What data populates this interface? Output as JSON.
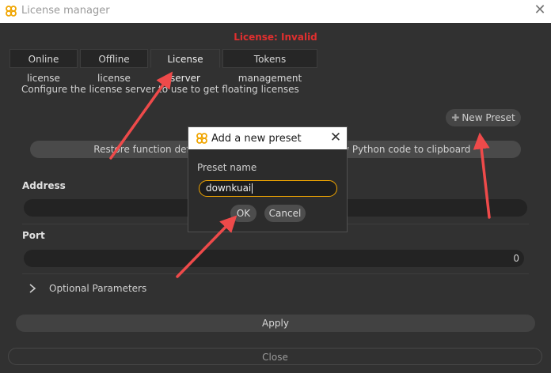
{
  "window": {
    "title": "License manager"
  },
  "status": {
    "text": "License: Invalid",
    "color": "#e02f2f"
  },
  "tabs": [
    {
      "label": "Online license"
    },
    {
      "label": "Offline license"
    },
    {
      "label": "License server",
      "active": true
    },
    {
      "label": "Tokens management"
    }
  ],
  "license_server": {
    "description": "Configure the license server to use to get floating licenses",
    "new_preset_label": "New Preset",
    "restore_label": "Restore function default",
    "copy_label": "Copy Python code to clipboard",
    "address_label": "Address",
    "address_value": "",
    "port_label": "Port",
    "port_value": "0",
    "optional_label": "Optional Parameters"
  },
  "footer": {
    "apply_label": "Apply",
    "close_label": "Close"
  },
  "dialog": {
    "title": "Add a new preset",
    "field_label": "Preset name",
    "field_value": "downkuai",
    "ok_label": "OK",
    "cancel_label": "Cancel"
  },
  "colors": {
    "accent": "#f0a500",
    "arrow": "#ee4a4a",
    "background": "#313131"
  },
  "icons": [
    "app-logo-icon",
    "close-icon",
    "plus-icon",
    "chevron-right-icon"
  ]
}
